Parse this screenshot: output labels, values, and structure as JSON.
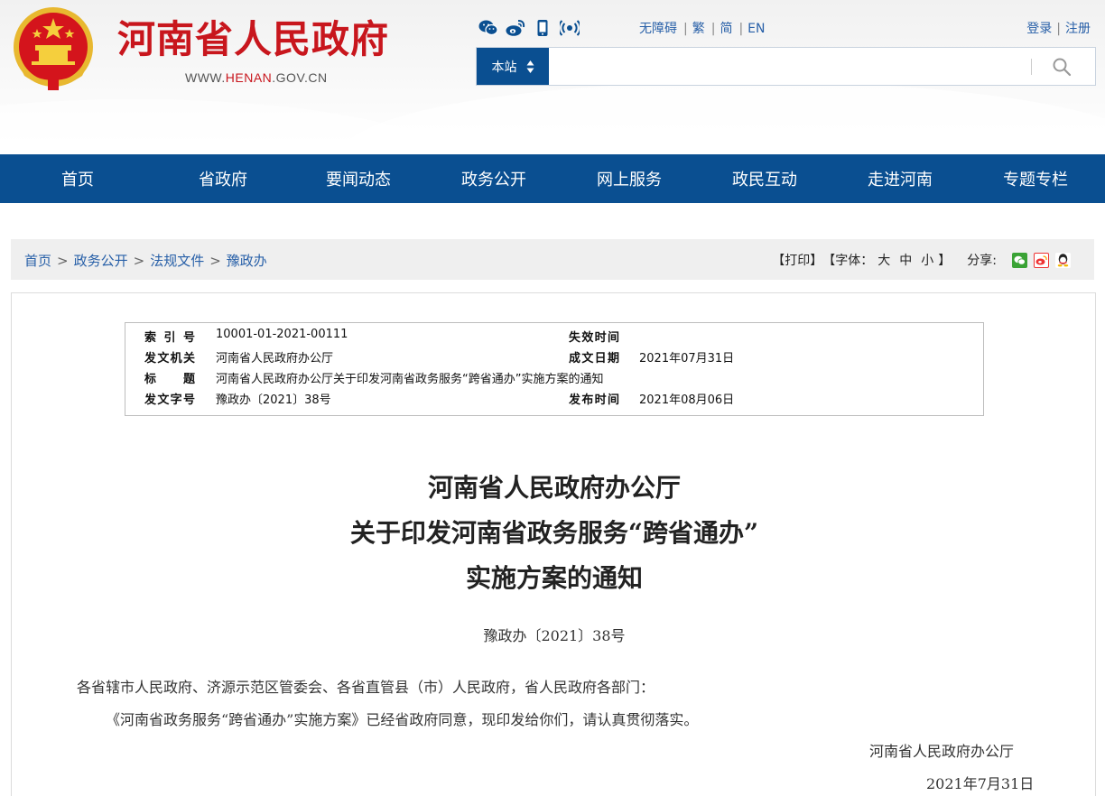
{
  "header": {
    "site_title": "河南省人民政府",
    "site_url_prefix": "WWW.",
    "site_url_brand": "HENAN",
    "site_url_suffix": ".GOV.CN",
    "social_icons": [
      "wechat-icon",
      "weibo-icon",
      "mobile-icon",
      "broadcast-icon"
    ],
    "lang_links": [
      "无障碍",
      "繁",
      "简",
      "EN"
    ],
    "login_label": "登录",
    "register_label": "注册",
    "search": {
      "scope_label": "本站",
      "placeholder": "",
      "value": ""
    },
    "brand_color": "#c8161d",
    "nav_color": "#0a4f91"
  },
  "nav": {
    "items": [
      "首页",
      "省政府",
      "要闻动态",
      "政务公开",
      "网上服务",
      "政民互动",
      "走进河南",
      "专题专栏"
    ]
  },
  "breadcrumb": {
    "items": [
      "首页",
      "政务公开",
      "法规文件",
      "豫政办"
    ],
    "separator": ">"
  },
  "tools": {
    "print_label": "【打印】",
    "font_open": "【字体：",
    "font_large": "大",
    "font_medium": "中",
    "font_small": "小",
    "font_close": "】",
    "share_label": "分享:",
    "share_icons": [
      "wechat-share-icon",
      "weibo-share-icon",
      "qq-share-icon"
    ]
  },
  "meta": {
    "index_no_label": "索引号",
    "index_no": "10001-01-2021-00111",
    "expiry_label": "失效时间",
    "expiry": "",
    "issuer_label": "发文机关",
    "issuer": "河南省人民政府办公厅",
    "created_label": "成文日期",
    "created": "2021年07月31日",
    "title_label": "标题",
    "title": "河南省人民政府办公厅关于印发河南省政务服务“跨省通办”实施方案的通知",
    "doc_no_label": "发文字号",
    "doc_no": "豫政办〔2021〕38号",
    "published_label": "发布时间",
    "published": "2021年08月06日"
  },
  "document": {
    "title_line1": "河南省人民政府办公厅",
    "title_line2": "关于印发河南省政务服务“跨省通办”",
    "title_line3": "实施方案的通知",
    "doc_number": "豫政办〔2021〕38号",
    "salutation": "各省辖市人民政府、济源示范区管委会、各省直管县（市）人民政府，省人民政府各部门：",
    "body": "《河南省政务服务“跨省通办”实施方案》已经省政府同意，现印发给你们，请认真贯彻落实。",
    "signature": "河南省人民政府办公厅",
    "date": "2021年7月31日"
  }
}
